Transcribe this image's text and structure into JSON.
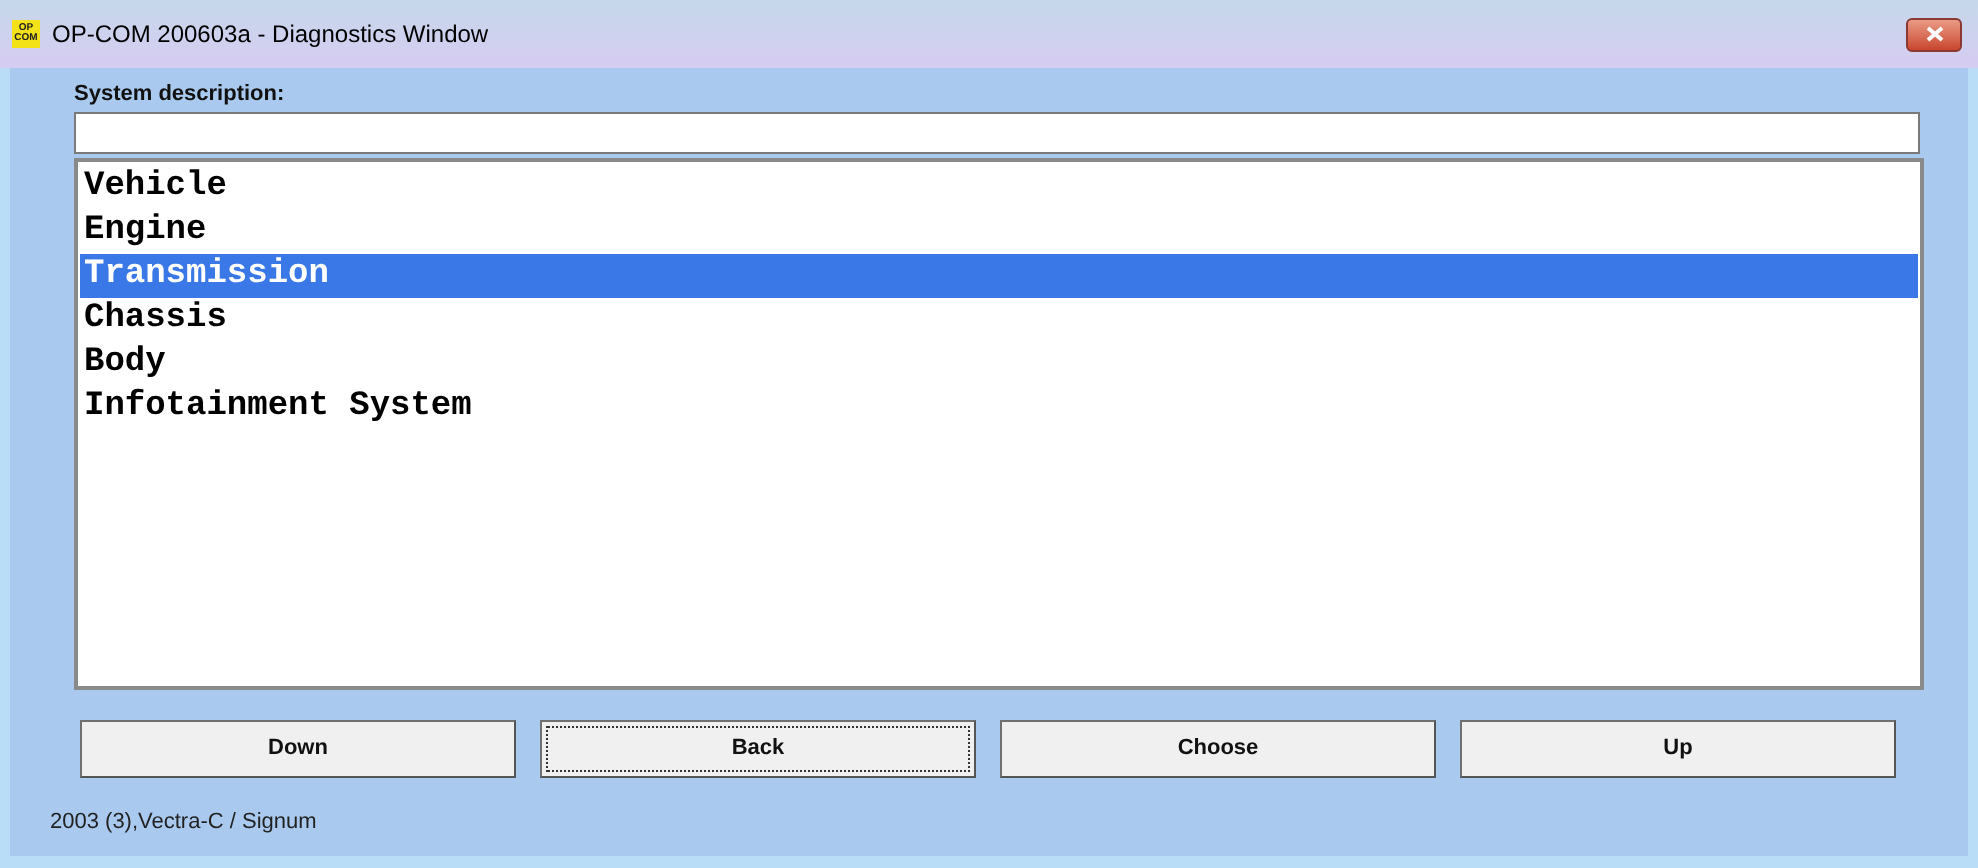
{
  "window": {
    "icon_text": [
      "OP",
      "COM"
    ],
    "title": "OP-COM 200603a - Diagnostics Window"
  },
  "system_description": {
    "label": "System description:"
  },
  "systems": [
    {
      "label": "Vehicle",
      "selected": false
    },
    {
      "label": "Engine",
      "selected": false
    },
    {
      "label": "Transmission",
      "selected": true
    },
    {
      "label": "Chassis",
      "selected": false
    },
    {
      "label": "Body",
      "selected": false
    },
    {
      "label": "Infotainment System",
      "selected": false
    }
  ],
  "buttons": [
    {
      "label": "Down",
      "focused": false
    },
    {
      "label": "Back",
      "focused": true
    },
    {
      "label": "Choose",
      "focused": false
    },
    {
      "label": "Up",
      "focused": false
    }
  ],
  "status": "2003 (3),Vectra-C / Signum"
}
